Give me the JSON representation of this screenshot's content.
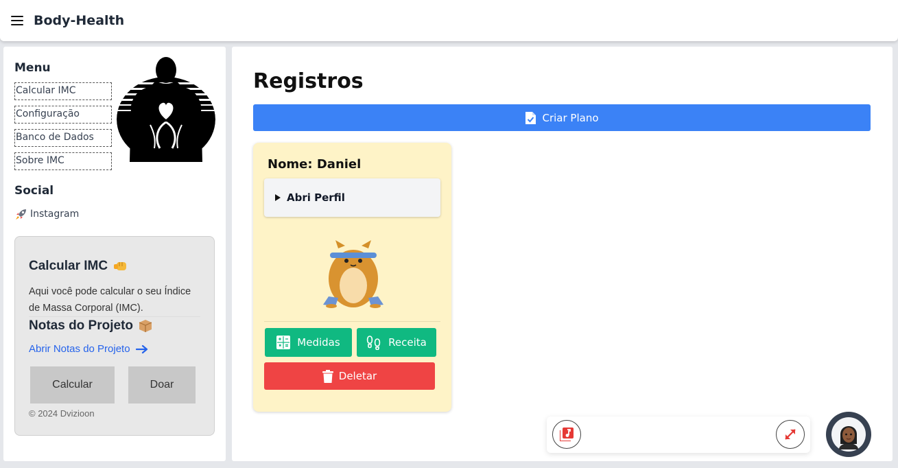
{
  "header": {
    "menu_icon": "hamburger-icon",
    "title": "Body-Health"
  },
  "sidebar": {
    "menu_title": "Menu",
    "items": [
      {
        "label": "Calcular IMC"
      },
      {
        "label": "Configuração"
      },
      {
        "label": "Banco de Dados"
      },
      {
        "label": "Sobre IMC"
      }
    ],
    "social_title": "Social",
    "social_link": {
      "icon": "rocket-icon",
      "label": "Instagram"
    },
    "logo": "body-silhouette-heart-logo"
  },
  "info_card": {
    "title": "Calcular IMC",
    "title_icon": "fist-bump-icon",
    "text": "Aqui você pode calcular o seu Índice de Massa Corporal (IMC).",
    "notes_title": "Notas do Projeto",
    "notes_icon": "package-icon",
    "notes_link": "Abrir Notas do Projeto",
    "notes_link_icon": "arrow-right-icon",
    "calc_button": "Calcular",
    "donate_button": "Doar",
    "copyright": "© 2024 Dvizioon"
  },
  "main": {
    "title": "Registros",
    "create_button": {
      "label": "Criar Plano",
      "icon": "file-check-icon"
    },
    "record": {
      "name": "Nome: Daniel",
      "profile_toggle": "Abri Perfil",
      "mascot": "exercising-hamster-illustration",
      "measures_button": {
        "label": "Medidas",
        "icon": "calculator-icon"
      },
      "recipe_button": {
        "label": "Receita",
        "icon": "footprints-icon"
      },
      "delete_button": {
        "label": "Deletar",
        "icon": "trash-icon"
      }
    }
  },
  "player": {
    "music_icon": "music-library-icon",
    "expand_icon": "expand-arrows-icon",
    "avatar": "assistant-avatar"
  },
  "colors": {
    "primary": "#3b82f6",
    "success": "#10b981",
    "danger": "#ef4444",
    "card_bg": "#fef3c7",
    "accent_icon": "#e53935"
  }
}
